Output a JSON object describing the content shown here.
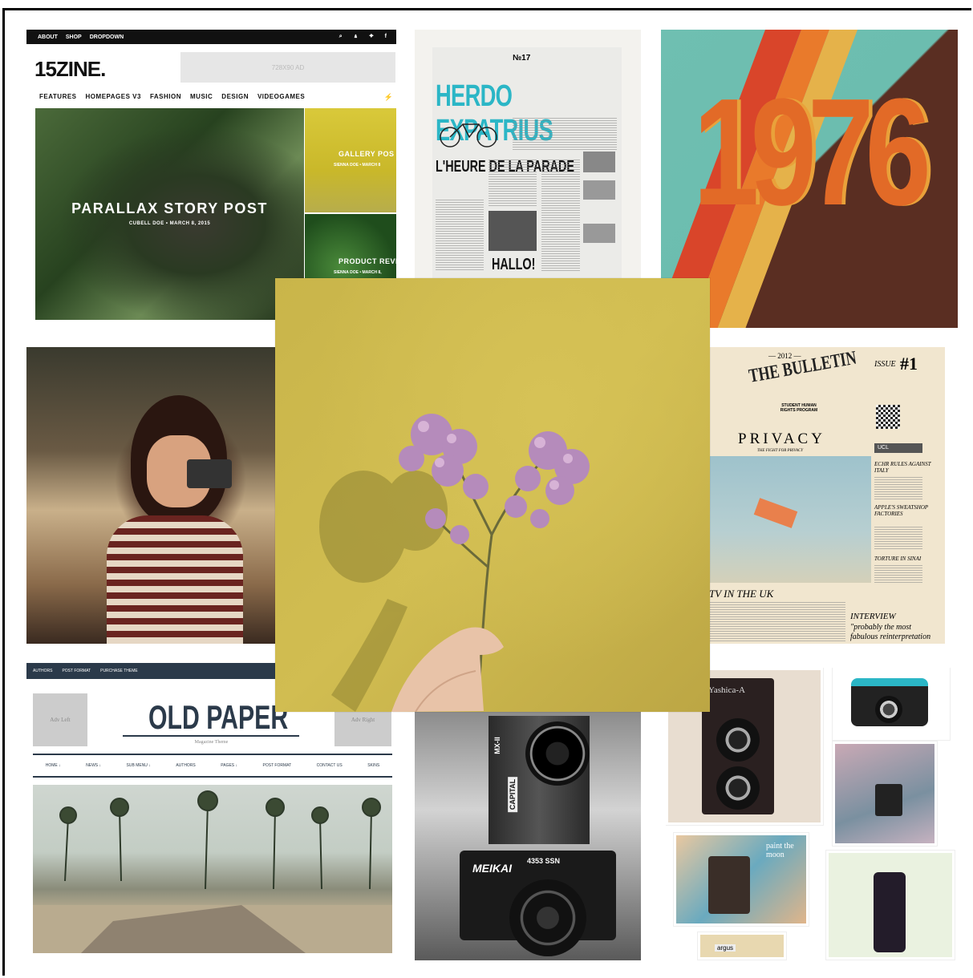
{
  "zine": {
    "top_nav": [
      "ABOUT",
      "SHOP",
      "DROPDOWN"
    ],
    "logo": "15ZINE.",
    "ad_text": "728X90 AD",
    "nav": [
      "FEATURES",
      "HOMEPAGES V3",
      "FASHION",
      "MUSIC",
      "DESIGN",
      "VIDEOGAMES"
    ],
    "hero_title": "PARALLAX STORY POST",
    "hero_meta": "CUBELL DOE  •  MARCH 8, 2015",
    "side1_title": "GALLERY POS",
    "side1_meta": "SIENNA DOE  •  MARCH 8",
    "side2_title": "PRODUCT REVI",
    "side2_meta": "SIENNA DOE  •  MARCH 8,"
  },
  "herdo": {
    "masthead": "HERDO EXPATRIUS",
    "issue": "№17",
    "headline": "L'HEURE DE LA PARADE",
    "subhead": "HALLO!"
  },
  "poster": {
    "year": "1976"
  },
  "bulletin": {
    "year": "— 2012 —",
    "title": "THE BULLETIN",
    "subtitle": "STUDENT HUMAN RIGHTS PROGRAM",
    "issue": "ISSUE",
    "number": "#1",
    "privacy": "PRIVACY",
    "privacy_sub": "THE FIGHT FOR PRIVACY",
    "tv": "TV IN THE UK",
    "interview": "INTERVIEW",
    "quote": "\"probably the most fabulous reinterpretation",
    "side_items": [
      "ECHR RULES AGAINST ITALY",
      "APPLE'S SWEATSHOP FACTORIES",
      "TORTURE IN SINAI"
    ],
    "ucl": "UCL"
  },
  "old_paper": {
    "top_nav": [
      "AUTHORS",
      "POST FORMAT",
      "PURCHASE THEME"
    ],
    "ad_left": "Adv Left",
    "ad_right": "Adv Right",
    "title": "OLD PAPER",
    "tagline": "Magazine Theme",
    "nav": [
      "HOME ↓",
      "NEWS ↓",
      "SUB MENU ↓",
      "AUTHORS",
      "PAGES ↓",
      "POST FORMAT",
      "CONTACT US",
      "SKINS"
    ]
  },
  "camera": {
    "brand_top": "MX-II",
    "capital": "CAPITAL",
    "brand": "MEIKAI",
    "model": "4353 SSN"
  },
  "vintage": {
    "yashica": "Yashica-A",
    "moon": "paint the moon",
    "argus": "argus"
  },
  "colors": {
    "teal": "#6fbfb1",
    "brown": "#5a2e22",
    "mustard": "#c9b54a",
    "navy": "#2b3a4a"
  }
}
